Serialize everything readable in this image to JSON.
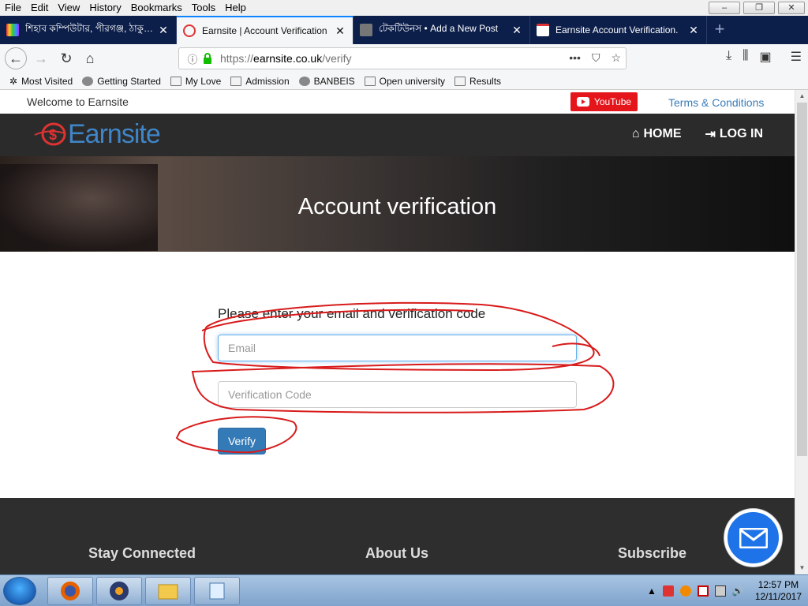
{
  "menu": [
    "File",
    "Edit",
    "View",
    "History",
    "Bookmarks",
    "Tools",
    "Help"
  ],
  "window_controls": [
    "–",
    "❐",
    "✕"
  ],
  "tabs": [
    {
      "title": "শিহাব কম্পিউটার, পীরগঞ্জ, ঠাকুরগাঁও।",
      "active": false
    },
    {
      "title": "Earnsite | Account Verification",
      "active": true
    },
    {
      "title": "টেকটিউনস • Add a New Post",
      "active": false
    },
    {
      "title": "Earnsite Account Verification.",
      "active": false
    }
  ],
  "url": {
    "protocol": "https://",
    "host": "earnsite.co.uk",
    "path": "/verify"
  },
  "bookmarks": [
    "Most Visited",
    "Getting Started",
    "My Love",
    "Admission",
    "BANBEIS",
    "Open university",
    "Results"
  ],
  "site": {
    "welcome": "Welcome to Earnsite",
    "youtube": "YouTube",
    "terms": "Terms & Conditions",
    "logo": "Earnsite",
    "nav": [
      "HOME",
      "LOG IN"
    ],
    "hero_title": "Account verification",
    "form_title": "Please enter your email and verification code",
    "email_placeholder": "Email",
    "code_placeholder": "Verification Code",
    "verify_label": "Verify",
    "footer": [
      "Stay Connected",
      "About Us",
      "Subscribe"
    ]
  },
  "taskbar": {
    "time": "12:57 PM",
    "date": "12/11/2017"
  },
  "colors": {
    "tabbar": "#0c1e4a",
    "header": "#2b2b2b",
    "brand": "#3f85c8",
    "button": "#337ab7",
    "youtube": "#e4151b",
    "annotation": "#d81b1b",
    "fab": "#1e73e8"
  }
}
